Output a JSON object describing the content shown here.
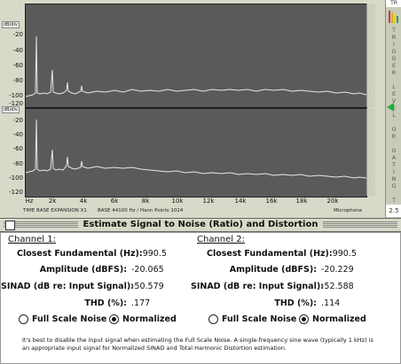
{
  "analyzer": {
    "y_labels_top": [
      "-20",
      "-40",
      "-60",
      "-80",
      "-100",
      "-120"
    ],
    "y_labels_bottom": [
      "-20",
      "-40",
      "-60",
      "-80",
      "-100",
      "-120"
    ],
    "db_tag": "dB/div",
    "x_labels": [
      "Hz",
      "2k",
      "4k",
      "6k",
      "8k",
      "10k",
      "12k",
      "14k",
      "16k",
      "18k",
      "20k"
    ],
    "status_left": "TIME BASE EXPANSION X1",
    "status_mid": "BASE 44100 Hz / Hann  Points  1024",
    "status_right": "Microphone",
    "trace_color": "#e6e6e6",
    "plot_bg": "#5a5a5a"
  },
  "sidebar": {
    "top_label": "TR",
    "vertical_text": "TRIGGER LEVEL OR GATING THRESHOLD",
    "bottom_value": "2.5",
    "led_colors": [
      "#d23a2a",
      "#e0a52a",
      "#e0d12a",
      "#3ba33b"
    ]
  },
  "dialog": {
    "title": "Estimate Signal to Noise (Ratio) and Distortion",
    "channel1": {
      "label": "Channel 1:",
      "fundamental_label": "Closest Fundamental (Hz):",
      "fundamental_value": "990.5",
      "amplitude_label": "Amplitude (dBFS):",
      "amplitude_value": "-20.065",
      "sinad_label": "SINAD (dB re: Input Signal):",
      "sinad_value": "-50.579",
      "thd_label": "THD (%):",
      "thd_value": ".177",
      "radio_full": "Full Scale Noise",
      "radio_norm": "Normalized"
    },
    "channel2": {
      "label": "Channel 2:",
      "fundamental_label": "Closest Fundamental (Hz):",
      "fundamental_value": "990.5",
      "amplitude_label": "Amplitude (dBFS):",
      "amplitude_value": "-20.229",
      "sinad_label": "SINAD (dB re: Input Signal):",
      "sinad_value": "-52.588",
      "thd_label": "THD (%):",
      "thd_value": ".114",
      "radio_full": "Full Scale Noise",
      "radio_norm": "Normalized"
    },
    "note": "It's best to disable the input signal when estimating the Full Scale Noise.  A single-frequency sine wave (typically 1 kHz) is an appropriate input signal for Normalized SINAD and Total Harmonic Distortion estimation."
  }
}
